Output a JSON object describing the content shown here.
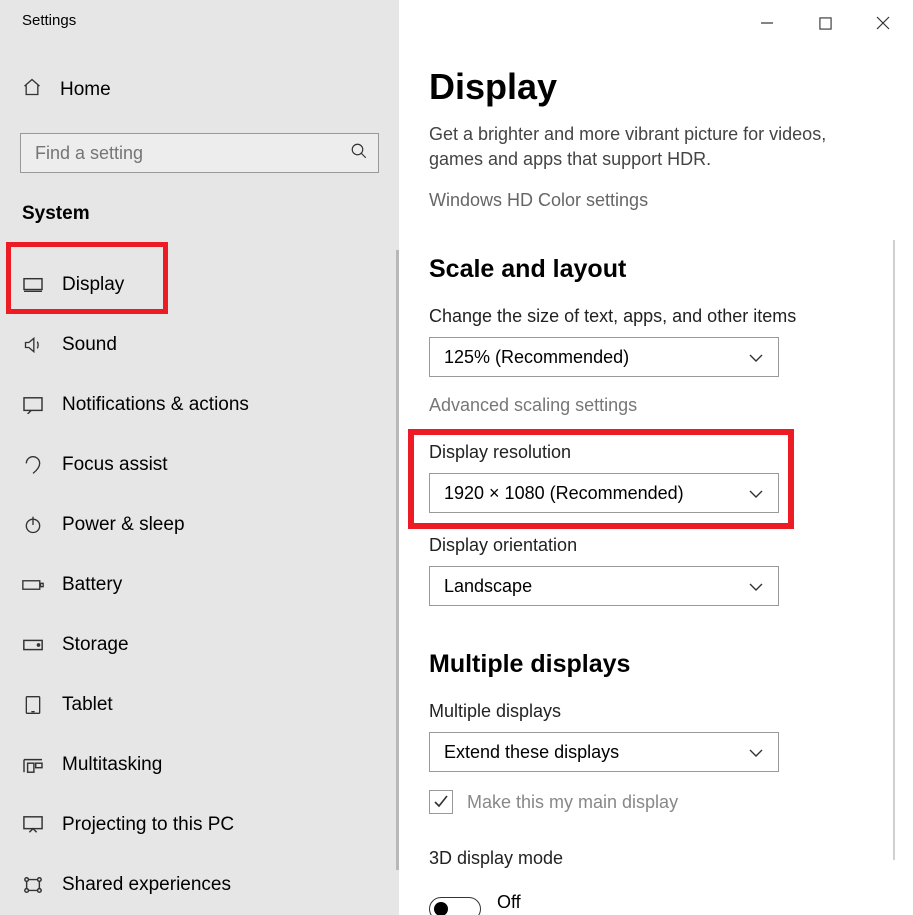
{
  "window_title": "Settings",
  "titlebar": {
    "min": "minimize",
    "max": "maximize",
    "close": "close"
  },
  "home_label": "Home",
  "search": {
    "placeholder": "Find a setting"
  },
  "section": "System",
  "nav": [
    {
      "label": "Display",
      "icon": "display-icon",
      "selected": true
    },
    {
      "label": "Sound",
      "icon": "sound-icon"
    },
    {
      "label": "Notifications & actions",
      "icon": "notifications-icon"
    },
    {
      "label": "Focus assist",
      "icon": "focus-icon"
    },
    {
      "label": "Power & sleep",
      "icon": "power-icon"
    },
    {
      "label": "Battery",
      "icon": "battery-icon"
    },
    {
      "label": "Storage",
      "icon": "storage-icon"
    },
    {
      "label": "Tablet",
      "icon": "tablet-icon"
    },
    {
      "label": "Multitasking",
      "icon": "multitask-icon"
    },
    {
      "label": "Projecting to this PC",
      "icon": "project-icon"
    },
    {
      "label": "Shared experiences",
      "icon": "share-icon"
    }
  ],
  "page": {
    "title": "Display",
    "intro": "Get a brighter and more vibrant picture for videos, games and apps that support HDR.",
    "hd_link": "Windows HD Color settings",
    "scale_heading": "Scale and layout",
    "scale_label": "Change the size of text, apps, and other items",
    "scale_value": "125% (Recommended)",
    "adv_scaling": "Advanced scaling settings",
    "res_label": "Display resolution",
    "res_value": "1920 × 1080 (Recommended)",
    "orient_label": "Display orientation",
    "orient_value": "Landscape",
    "multi_heading": "Multiple displays",
    "multi_label": "Multiple displays",
    "multi_value": "Extend these displays",
    "main_check": "Make this my main display",
    "mode3d_label": "3D display mode",
    "mode3d_value": "Off"
  }
}
